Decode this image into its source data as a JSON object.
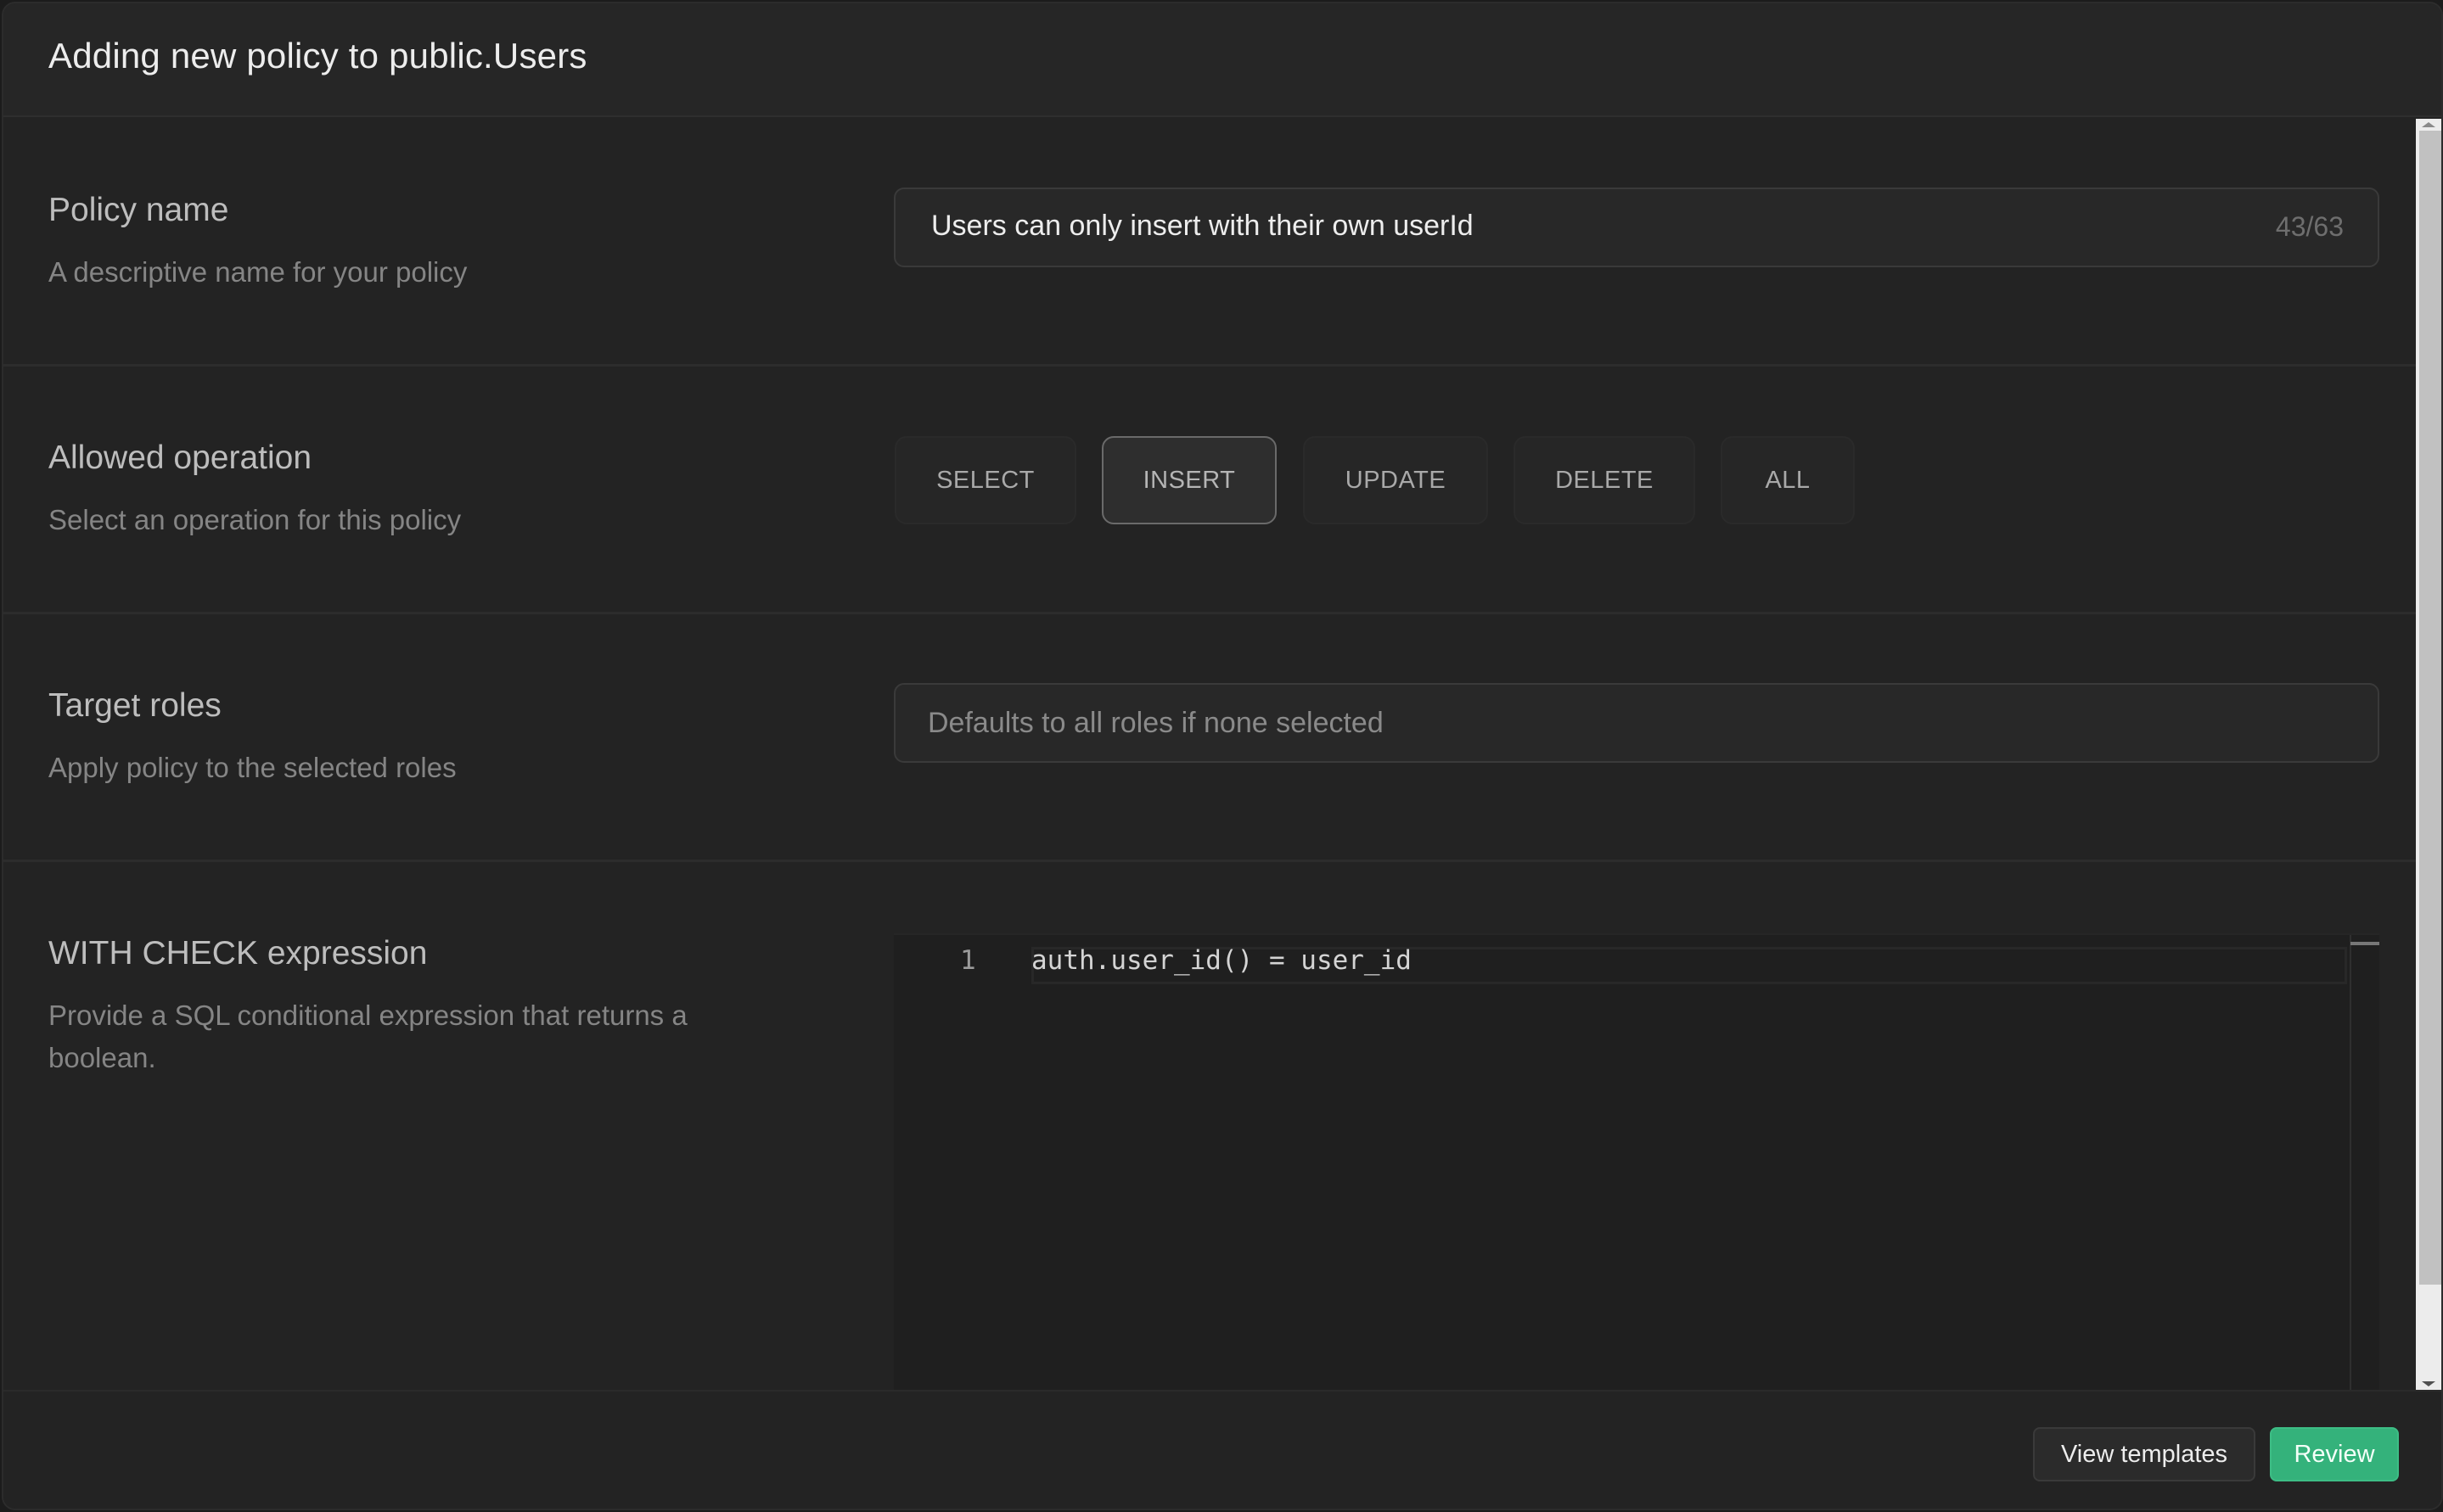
{
  "header": {
    "title": "Adding new policy to public.Users"
  },
  "sections": {
    "policy_name": {
      "title": "Policy name",
      "description": "A descriptive name for your policy",
      "input_value": "Users can only insert with their own userId",
      "char_counter": "43/63"
    },
    "allowed_operation": {
      "title": "Allowed operation",
      "description": "Select an operation for this policy",
      "options": [
        {
          "label": "SELECT",
          "selected": false
        },
        {
          "label": "INSERT",
          "selected": true
        },
        {
          "label": "UPDATE",
          "selected": false
        },
        {
          "label": "DELETE",
          "selected": false
        },
        {
          "label": "ALL",
          "selected": false
        }
      ]
    },
    "target_roles": {
      "title": "Target roles",
      "description": "Apply policy to the selected roles",
      "placeholder": "Defaults to all roles if none selected"
    },
    "with_check": {
      "title": "WITH CHECK expression",
      "description": "Provide a SQL conditional expression that returns a boolean.",
      "editor": {
        "lines": [
          {
            "number": "1",
            "code": "auth.user_id() = user_id"
          }
        ]
      }
    }
  },
  "footer": {
    "view_templates_label": "View templates",
    "review_label": "Review"
  },
  "colors": {
    "accent": "#34b27b",
    "background": "#232323",
    "header_bg": "#262626"
  }
}
